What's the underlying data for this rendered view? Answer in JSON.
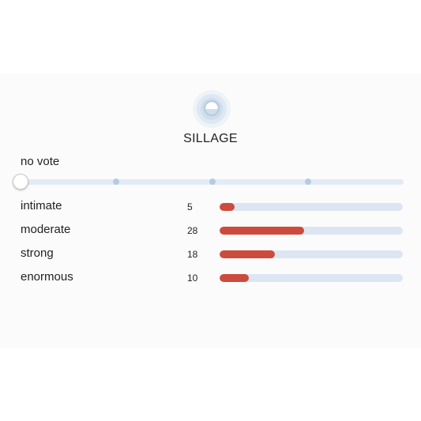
{
  "accent_color": "#cc4b3c",
  "track_color": "#dce6f3",
  "icon": "sillage-icon",
  "title": "SILLAGE",
  "vote": {
    "current_label": "no vote",
    "slider_stops": 5,
    "selected_index": 0
  },
  "ratings": [
    {
      "label": "intimate",
      "count": "5",
      "fraction": 0.08
    },
    {
      "label": "moderate",
      "count": "28",
      "fraction": 0.46
    },
    {
      "label": "strong",
      "count": "18",
      "fraction": 0.3
    },
    {
      "label": "enormous",
      "count": "10",
      "fraction": 0.16
    }
  ]
}
